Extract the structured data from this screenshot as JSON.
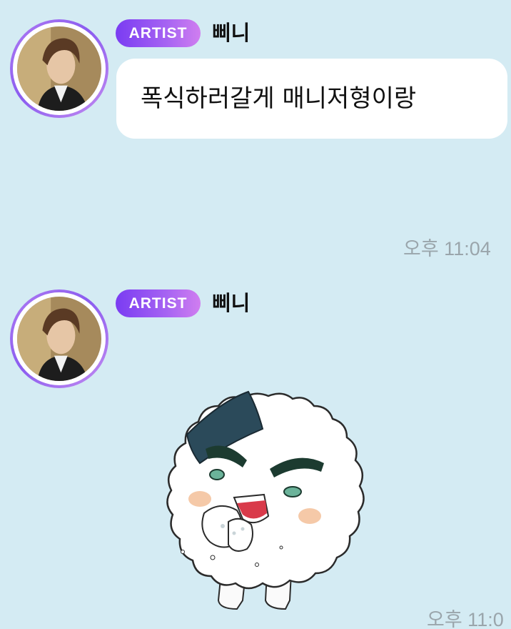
{
  "messages": [
    {
      "badge": "ARTIST",
      "sender": "삐니",
      "text": "폭식하러갈게 매니저형이랑",
      "time": "오후 11:04"
    },
    {
      "badge": "ARTIST",
      "sender": "삐니",
      "sticker": "rice-ball-character-eating-sticker",
      "time": "오후 11:0"
    }
  ],
  "colors": {
    "background": "#d4ebf3",
    "bubble": "#ffffff",
    "badge_start": "#7a3cf2",
    "badge_end": "#d07ef0",
    "time_text": "#9aa5ab"
  }
}
